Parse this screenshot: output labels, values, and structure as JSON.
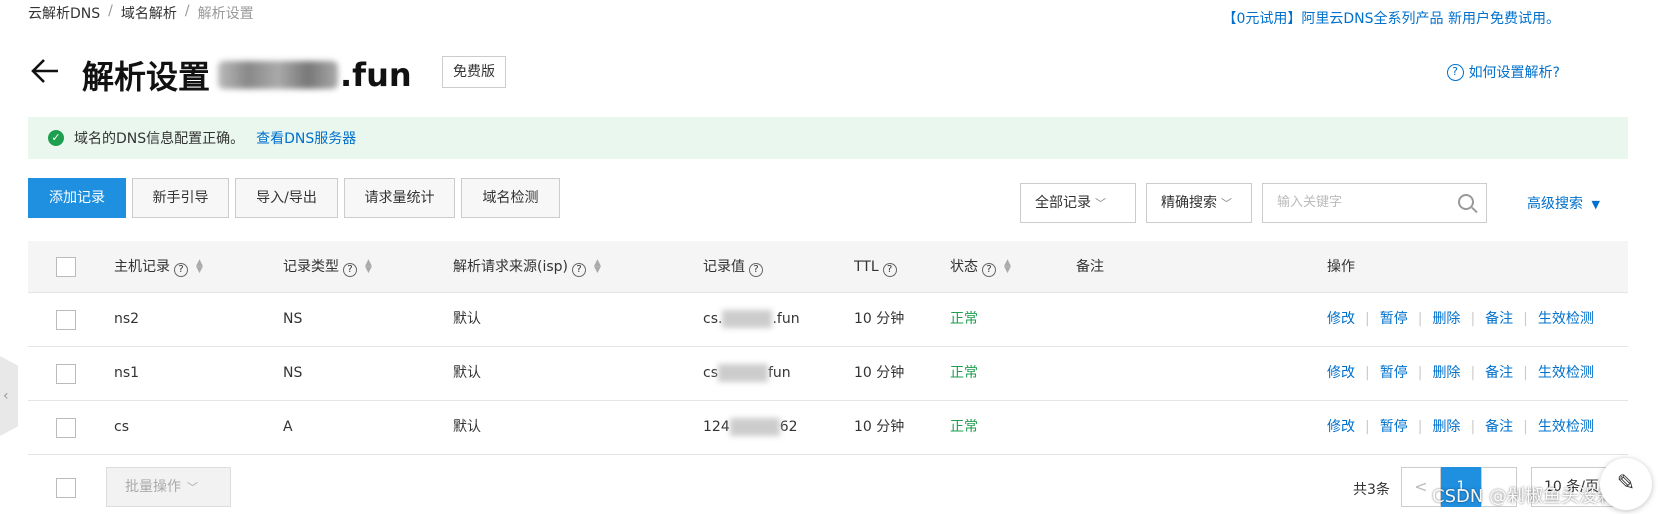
{
  "breadcrumb": {
    "items": [
      "云解析DNS",
      "域名解析",
      "解析设置"
    ],
    "sep": "/"
  },
  "promo": "【0元试用】阿里云DNS全系列产品 新用户免费试用。",
  "header": {
    "title": "解析设置",
    "domain_suffix": ".fun",
    "badge": "免费版",
    "help": "如何设置解析?"
  },
  "notice": {
    "text": "域名的DNS信息配置正确。",
    "link": "查看DNS服务器"
  },
  "toolbar": {
    "buttons": [
      "添加记录",
      "新手引导",
      "导入/导出",
      "请求量统计",
      "域名检测"
    ],
    "filter": "全部记录",
    "search_mode": "精确搜索",
    "search_placeholder": "输入关键字",
    "advanced": "高级搜索"
  },
  "table": {
    "columns": [
      "主机记录",
      "记录类型",
      "解析请求来源(isp)",
      "记录值",
      "TTL",
      "状态",
      "备注",
      "操作"
    ],
    "rows": [
      {
        "host": "ns2",
        "type": "NS",
        "isp": "默认",
        "value_pre": "cs.",
        "value_post": ".fun",
        "ttl": "10 分钟",
        "status": "正常"
      },
      {
        "host": "ns1",
        "type": "NS",
        "isp": "默认",
        "value_pre": "cs",
        "value_post": "fun",
        "ttl": "10 分钟",
        "status": "正常"
      },
      {
        "host": "cs",
        "type": "A",
        "isp": "默认",
        "value_pre": "124",
        "value_post": "62",
        "ttl": "10 分钟",
        "status": "正常"
      }
    ],
    "actions": [
      "修改",
      "暂停",
      "删除",
      "备注",
      "生效检测"
    ]
  },
  "footer": {
    "batch": "批量操作",
    "total": "共3条",
    "page": "1",
    "page_size": "10 条/页"
  },
  "watermark": "CSDN @剁椒鱼头没剁椒",
  "colors": {
    "accent": "#1f8fe0",
    "link": "#0070cc",
    "success": "#1e9e4f",
    "notice_bg": "#e9f7ef"
  }
}
